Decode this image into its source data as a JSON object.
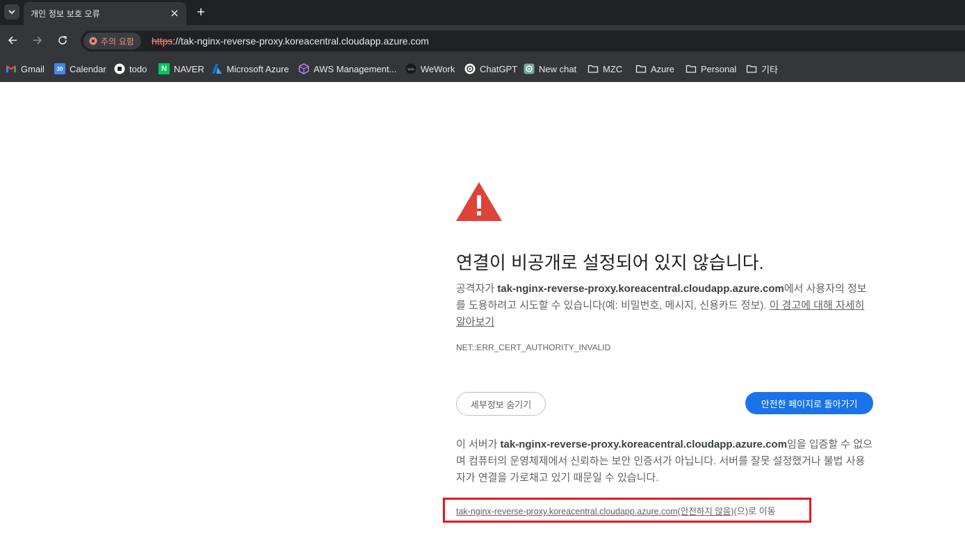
{
  "browser": {
    "tab_title": "개인 정보 보호 오류",
    "security_chip": "주의 요함",
    "url_scheme": "https",
    "url_rest": "://tak-nginx-reverse-proxy.koreacentral.cloudapp.azure.com",
    "bookmarks": [
      {
        "label": "Gmail",
        "icon": "gmail-icon"
      },
      {
        "label": "Calendar",
        "icon": "calendar-icon",
        "icon_text": "30"
      },
      {
        "label": "todo",
        "icon": "todo-icon"
      },
      {
        "label": "NAVER",
        "icon": "naver-icon",
        "icon_text": "N"
      },
      {
        "label": "Microsoft Azure",
        "icon": "azure-icon"
      },
      {
        "label": "AWS Management...",
        "icon": "aws-icon"
      },
      {
        "label": "WeWork",
        "icon": "wework-icon"
      },
      {
        "label": "ChatGPT",
        "icon": "chatgpt-icon"
      },
      {
        "label": "New chat",
        "icon": "chatgpt-icon"
      },
      {
        "label": "MZC",
        "icon": "folder-icon"
      },
      {
        "label": "Azure",
        "icon": "folder-icon"
      },
      {
        "label": "Personal",
        "icon": "folder-icon"
      },
      {
        "label": "기타",
        "icon": "folder-icon"
      }
    ]
  },
  "page": {
    "heading": "연결이 비공개로 설정되어 있지 않습니다.",
    "explanation_prefix": "공격자가 ",
    "host": "tak-nginx-reverse-proxy.koreacentral.cloudapp.azure.com",
    "explanation_suffix": "에서 사용자의 정보를 도용하려고 시도할 수 있습니다(예: 비밀번호, 메시지, 신용카드 정보). ",
    "learn_more": "이 경고에 대해 자세히 알아보기",
    "error_code": "NET::ERR_CERT_AUTHORITY_INVALID",
    "details_button": "세부정보 숨기기",
    "back_button": "안전한 페이지로 돌아가기",
    "details_prefix": "이 서버가 ",
    "details_suffix": "임을 입증할 수 없으며 컴퓨터의 운영체제에서 신뢰하는 보안 인증서가 아닙니다. 서버를 잘못 설정했거나 불법 사용자가 연결을 가로채고 있기 때문일 수 있습니다.",
    "proceed_link": "tak-nginx-reverse-proxy.koreacentral.cloudapp.azure.com(안전하지 않음)",
    "proceed_suffix": "(으)로 이동"
  },
  "colors": {
    "warning_red": "#db4437",
    "primary_blue": "#1a73e8",
    "highlight_box": "#e8151b"
  }
}
